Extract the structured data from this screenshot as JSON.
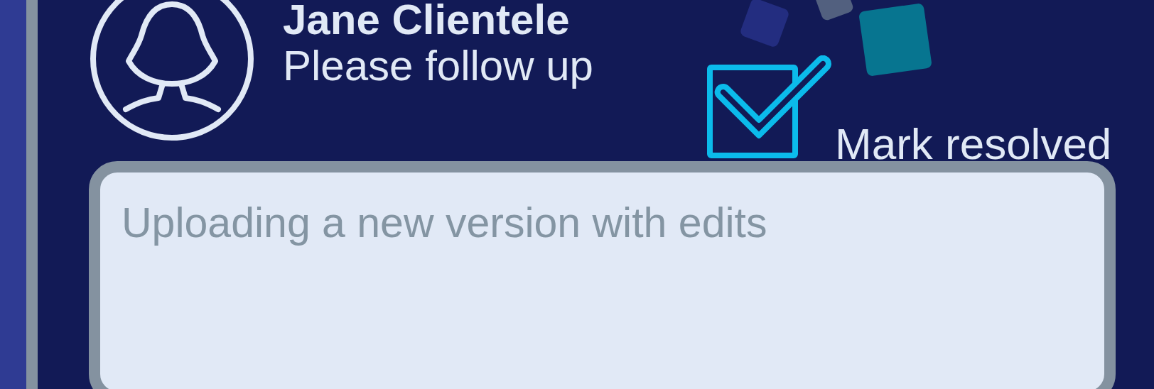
{
  "author": {
    "name": "Jane Clientele",
    "note": "Please follow up"
  },
  "resolve": {
    "label": "Mark resolved",
    "checked": true
  },
  "reply": {
    "placeholder": "Uploading a new version with edits"
  }
}
